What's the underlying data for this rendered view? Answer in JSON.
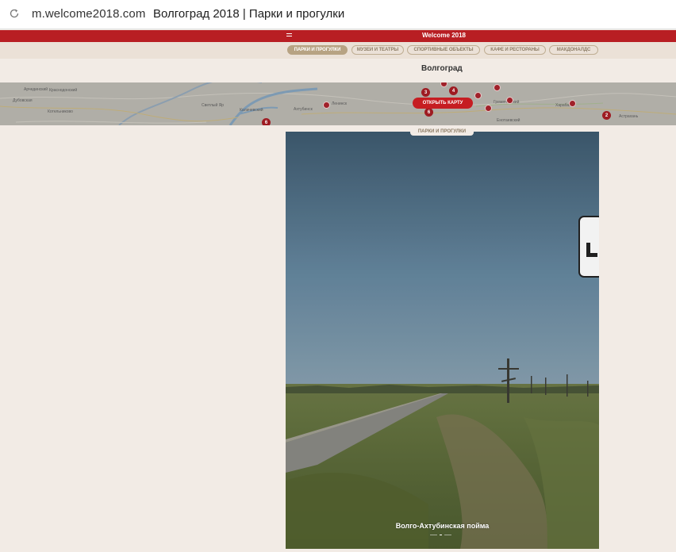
{
  "browser": {
    "url": "m.welcome2018.com",
    "title": "Волгоград 2018 | Парки и прогулки"
  },
  "topbar": {
    "brand": "Welcome 2018",
    "menu_icon": "hamburger-icon",
    "color": "#b81e23"
  },
  "categories": [
    {
      "label": "ПАРКИ И ПРОГУЛКИ",
      "active": true
    },
    {
      "label": "МУЗЕИ И ТЕАТРЫ",
      "active": false
    },
    {
      "label": "СПОРТИВНЫЕ ОБЪЕКТЫ",
      "active": false
    },
    {
      "label": "КАФЕ И РЕСТОРАНЫ",
      "active": false
    },
    {
      "label": "МАКДОНАЛДС",
      "active": false
    }
  ],
  "city": "Волгоград",
  "map": {
    "open_button": "ОТКРЫТЬ КАРТУ",
    "markers": [
      "3",
      "4",
      "6",
      "2",
      "6"
    ]
  },
  "section_tag": "ПАРКИ И ПРОГУЛКИ",
  "card": {
    "place_name": "Волго-Ахтубинская пойма",
    "slides": 3,
    "active_slide": 1
  }
}
